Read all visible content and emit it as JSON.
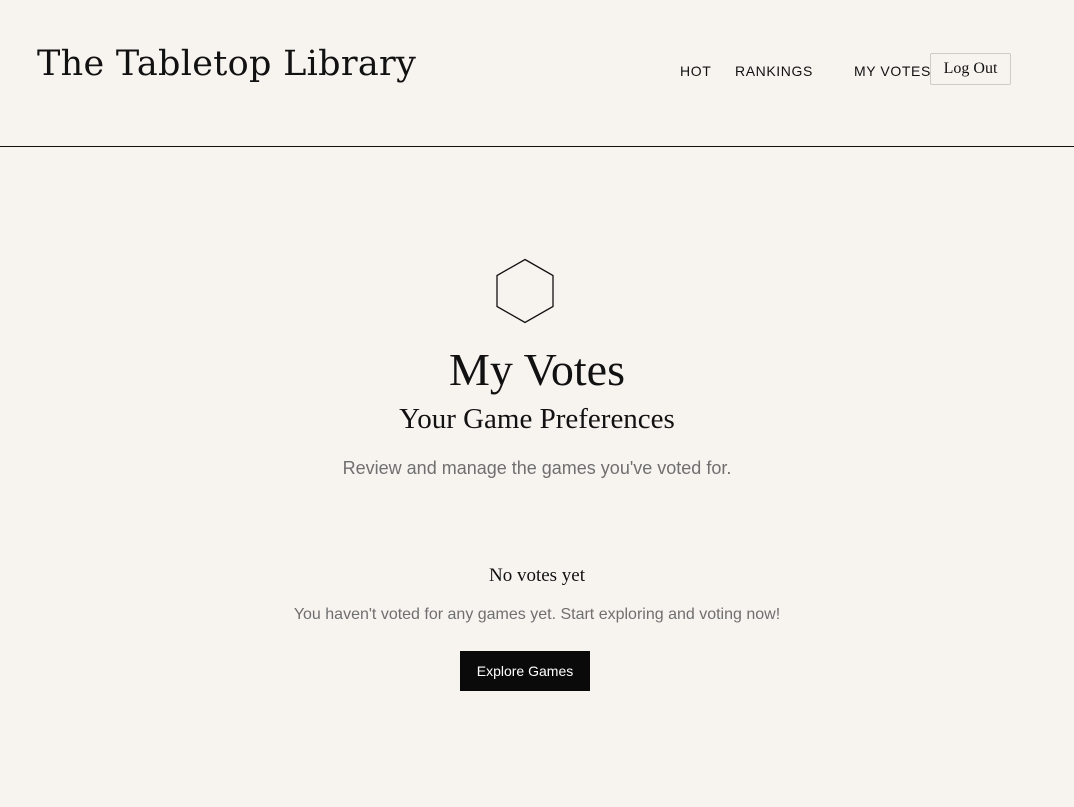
{
  "header": {
    "brand": "The Tabletop Library",
    "nav": {
      "hot": "HOT",
      "rankings": "RANKINGS",
      "my_votes": "MY VOTES"
    },
    "logout_label": "Log Out"
  },
  "main": {
    "icon": "hexagon-icon",
    "title": "My Votes",
    "subtitle": "Your Game Preferences",
    "description": "Review and manage the games you've voted for."
  },
  "empty_state": {
    "title": "No votes yet",
    "message": "You haven't voted for any games yet. Start exploring and voting now!",
    "button_label": "Explore Games"
  },
  "colors": {
    "background": "#f7f4f0",
    "text": "#111111",
    "muted_text": "#6f6f6f",
    "button_bg": "#0a0a0a",
    "button_text": "#ffffff"
  }
}
